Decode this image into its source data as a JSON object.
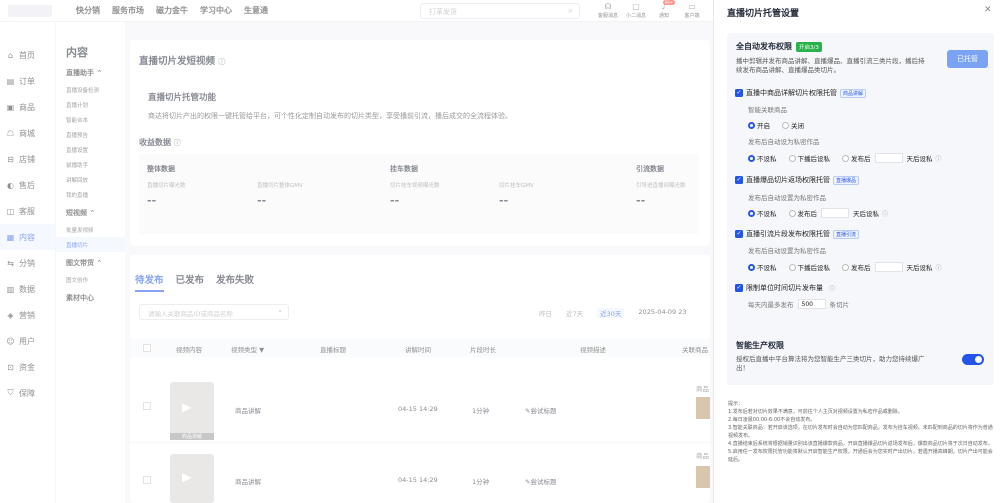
{
  "topnav": {
    "items": [
      "快分销",
      "服务市场",
      "磁力金牛",
      "学习中心",
      "生意通"
    ],
    "search_placeholder": "打革发货",
    "icons": [
      {
        "label": "客服消息",
        "icon": "headset-icon"
      },
      {
        "label": "小二消息",
        "icon": "chat-icon"
      },
      {
        "label": "通知",
        "icon": "bell-icon",
        "badge": "99+"
      },
      {
        "label": "客户端",
        "icon": "monitor-icon"
      }
    ]
  },
  "sidebar": {
    "items": [
      {
        "label": "首页",
        "icon": "home-icon"
      },
      {
        "label": "订单",
        "icon": "order-icon"
      },
      {
        "label": "商品",
        "icon": "goods-icon"
      },
      {
        "label": "商城",
        "icon": "mall-icon"
      },
      {
        "label": "店铺",
        "icon": "shop-icon"
      },
      {
        "label": "售后",
        "icon": "aftersale-icon"
      },
      {
        "label": "客服",
        "icon": "service-icon"
      },
      {
        "label": "内容",
        "icon": "content-icon",
        "active": true
      },
      {
        "label": "分销",
        "icon": "distribution-icon"
      },
      {
        "label": "数据",
        "icon": "data-icon"
      },
      {
        "label": "营销",
        "icon": "marketing-icon"
      },
      {
        "label": "用户",
        "icon": "user-icon"
      },
      {
        "label": "资金",
        "icon": "fund-icon"
      },
      {
        "label": "保障",
        "icon": "shield-icon"
      }
    ]
  },
  "subnav": {
    "title": "内容",
    "groups": [
      {
        "label": "直播助手",
        "items": [
          "直播设备检测",
          "直播计划",
          "智能台本",
          "直播预告",
          "直播设置",
          "鼠播助手",
          "讲解回放",
          "我的直播"
        ]
      },
      {
        "label": "短视频",
        "items": [
          "批量发视频",
          "直播切片"
        ]
      },
      {
        "label": "图文带货",
        "items": [
          "图文创作"
        ]
      },
      {
        "label": "素材中心",
        "items": []
      }
    ],
    "active": "直播切片"
  },
  "main": {
    "page_title": "直播切片发短视频",
    "intro_title": "直播切片托管功能",
    "intro_desc": "商达将切片产出的权限一键托管给平台，可个性化定制自动发布的切片类型，享受播前引流，播后成交的全流程体验。",
    "revenue_title": "收益数据",
    "stats": [
      {
        "group": "整体数据",
        "items": [
          {
            "label": "直播切片曝光数",
            "value": "--"
          },
          {
            "label": "直播切片整体GMV",
            "value": "--"
          }
        ]
      },
      {
        "group": "挂车数据",
        "items": [
          {
            "label": "切片挂车视频曝光数",
            "value": "--"
          },
          {
            "label": "切片挂车GMV",
            "value": "--"
          }
        ]
      },
      {
        "group": "引流数据",
        "items": [
          {
            "label": "引导进直播间曝光数",
            "value": "--"
          }
        ]
      }
    ],
    "tabs": [
      "待发布",
      "已发布",
      "发布失败"
    ],
    "filter_placeholder": "请输入关联商品ID或商品名称",
    "date_tabs": [
      "昨日",
      "近7天",
      "近30天"
    ],
    "date_start": "2025-04-09 23",
    "columns": [
      "视频内容",
      "视频类型",
      "直播标题",
      "讲解时间",
      "片段时长",
      "视频描述",
      "关联商品"
    ],
    "rows": [
      {
        "thumb_label": "商品讲解",
        "type": "商品讲解",
        "time": "04-15 14:29",
        "duration": "1分钟",
        "desc": "尝试标题",
        "product": "商品"
      },
      {
        "thumb_label": "",
        "type": "商品讲解",
        "time": "04-15 14:29",
        "duration": "1分钟",
        "desc": "尝试标题",
        "product": "商品"
      }
    ]
  },
  "drawer": {
    "title": "直播切片托管设置",
    "auto_title": "全自动发布权限",
    "auto_tag": "开启3/3",
    "auto_desc": "播中剪辑并发布商品讲解、直播爆品、直播引流三类片段，播后持续发布商品讲解、直播爆品类切片。",
    "managed_button": "已托管",
    "sections": [
      {
        "label": "直播中商品详解切片权限托管",
        "tag": "商品讲解",
        "sub1_label": "智能关联商品",
        "sub1_options": [
          "开启",
          "关闭"
        ],
        "sub2_label": "发布后自动设为私密作品",
        "options": [
          "不设私",
          "下播后设私",
          "发布后",
          "天后设私"
        ]
      },
      {
        "label": "直播爆品切片返场权限托管",
        "tag": "直播爆品",
        "sub2_label": "发布后自动设置为私密作品",
        "options": [
          "不设私",
          "发布后",
          "天后设私"
        ]
      },
      {
        "label": "直播引流片段发布权限托管",
        "tag": "直播引流",
        "sub2_label": "发布后自动设置为私密作品",
        "options": [
          "不设私",
          "下播后设私",
          "发布后",
          "天后设私"
        ]
      }
    ],
    "limit_label": "限制单位时间切片发布量",
    "limit_prefix": "每天内最多发布",
    "limit_value": "500",
    "limit_suffix": "条切片",
    "smart_title": "智能生产权限",
    "smart_desc": "授权后直播中平台算法将为您智能生产三类切片，助力您持续爆广出！",
    "smart_enabled": true,
    "tips_title": "提示：",
    "tips": [
      "1.发布后若对切片效果不满意，可前往个人主页对视频设置为私密作品或删除。",
      "2.每日凌晨00:00-6:00不会自动发布。",
      "3.智能关联商品：若开启该选项，在切片发布时会自动为您匹配商品，发布为挂车视频。未匹配到商品的切片将作为普通视频发布。",
      "4.直播结束后系统将根据销量识别出该直播爆款商品，开启直播爆品切片返场发布后，爆款商品切片将于次日自动发布。",
      "5.启用任一发布权限托管功能将默认开启智能生产权限，开通后会为您实时产出切片，若遇开播高峰期，切片产出可能会延后。"
    ]
  }
}
